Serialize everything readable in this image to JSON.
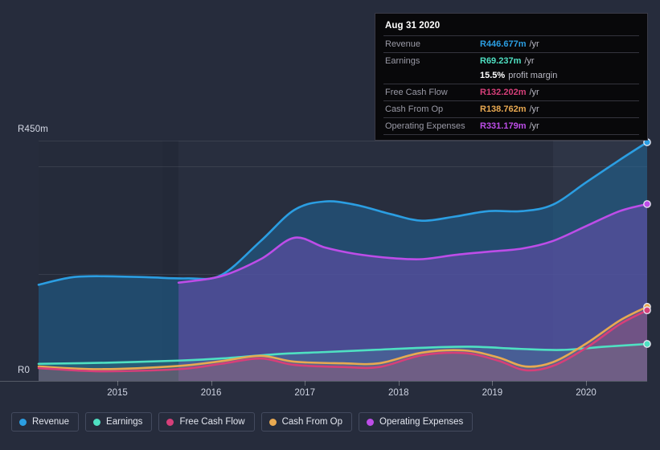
{
  "chart_data": {
    "type": "area",
    "title": "",
    "currency_prefix": "R",
    "xlabel": "",
    "ylabel": "",
    "ylim": [
      0,
      450
    ],
    "ytick_labels": [
      "R450m",
      "R0"
    ],
    "ytick_values": [
      450,
      0
    ],
    "grid": true,
    "x_tick_labels": [
      "2015",
      "2016",
      "2017",
      "2018",
      "2019",
      "2020"
    ],
    "legend_position": "bottom-left",
    "series": [
      {
        "name": "Revenue",
        "color": "#2b9ee2",
        "fill": "rgba(31,100,150,0.55)",
        "points": [
          [
            0.0,
            180
          ],
          [
            0.055,
            194
          ],
          [
            0.11,
            196
          ],
          [
            0.18,
            194
          ],
          [
            0.245,
            192
          ],
          [
            0.3,
            198
          ],
          [
            0.365,
            262
          ],
          [
            0.42,
            320
          ],
          [
            0.47,
            336
          ],
          [
            0.52,
            330
          ],
          [
            0.58,
            312
          ],
          [
            0.63,
            300
          ],
          [
            0.685,
            308
          ],
          [
            0.74,
            318
          ],
          [
            0.795,
            318
          ],
          [
            0.845,
            330
          ],
          [
            0.9,
            372
          ],
          [
            0.955,
            414
          ],
          [
            1.0,
            447
          ]
        ],
        "endpoint_value": 446.677
      },
      {
        "name": "Earnings",
        "color": "#4fe0c2",
        "fill": "rgba(70,160,160,0.22)",
        "points": [
          [
            0.0,
            32
          ],
          [
            0.11,
            34
          ],
          [
            0.23,
            38
          ],
          [
            0.3,
            42
          ],
          [
            0.39,
            50
          ],
          [
            0.47,
            54
          ],
          [
            0.55,
            58
          ],
          [
            0.63,
            62
          ],
          [
            0.71,
            64
          ],
          [
            0.79,
            60
          ],
          [
            0.86,
            58
          ],
          [
            0.93,
            64
          ],
          [
            1.0,
            69.2
          ]
        ],
        "endpoint_value": 69.237
      },
      {
        "name": "Free Cash Flow",
        "color": "#d63f79",
        "fill": "rgba(180,70,120,0.22)",
        "points": [
          [
            0.0,
            24
          ],
          [
            0.1,
            18
          ],
          [
            0.23,
            22
          ],
          [
            0.3,
            32
          ],
          [
            0.365,
            42
          ],
          [
            0.42,
            30
          ],
          [
            0.5,
            26
          ],
          [
            0.56,
            26
          ],
          [
            0.63,
            48
          ],
          [
            0.7,
            52
          ],
          [
            0.755,
            38
          ],
          [
            0.8,
            20
          ],
          [
            0.845,
            28
          ],
          [
            0.9,
            62
          ],
          [
            0.955,
            106
          ],
          [
            1.0,
            132.2
          ]
        ],
        "endpoint_value": 132.202
      },
      {
        "name": "Cash From Op",
        "color": "#e8a951",
        "fill": "rgba(200,150,80,0.15)",
        "points": [
          [
            0.0,
            27
          ],
          [
            0.1,
            22
          ],
          [
            0.23,
            28
          ],
          [
            0.3,
            37
          ],
          [
            0.365,
            47
          ],
          [
            0.42,
            36
          ],
          [
            0.5,
            33
          ],
          [
            0.56,
            33
          ],
          [
            0.63,
            53
          ],
          [
            0.7,
            57
          ],
          [
            0.755,
            44
          ],
          [
            0.8,
            27
          ],
          [
            0.845,
            35
          ],
          [
            0.9,
            70
          ],
          [
            0.955,
            113
          ],
          [
            1.0,
            138.8
          ]
        ],
        "endpoint_value": 138.762
      },
      {
        "name": "Operating Expenses",
        "color": "#bd4de8",
        "fill": "rgba(98,78,168,0.62)",
        "points": [
          [
            0.23,
            184
          ],
          [
            0.3,
            196
          ],
          [
            0.365,
            228
          ],
          [
            0.42,
            268
          ],
          [
            0.47,
            250
          ],
          [
            0.52,
            238
          ],
          [
            0.58,
            230
          ],
          [
            0.63,
            228
          ],
          [
            0.685,
            236
          ],
          [
            0.74,
            242
          ],
          [
            0.795,
            248
          ],
          [
            0.845,
            262
          ],
          [
            0.9,
            290
          ],
          [
            0.955,
            318
          ],
          [
            1.0,
            331.2
          ]
        ],
        "endpoint_value": 331.179
      }
    ]
  },
  "tooltip": {
    "date": "Aug 31 2020",
    "rows": [
      {
        "label": "Revenue",
        "value": "R446.677m",
        "unit": "/yr",
        "color": "#2b9ee2"
      },
      {
        "label": "Earnings",
        "value": "R69.237m",
        "unit": "/yr",
        "color": "#4fe0c2"
      },
      {
        "label": "",
        "value": "15.5%",
        "unit": "profit margin",
        "color": "#ffffff"
      },
      {
        "label": "Free Cash Flow",
        "value": "R132.202m",
        "unit": "/yr",
        "color": "#d63f79"
      },
      {
        "label": "Cash From Op",
        "value": "R138.762m",
        "unit": "/yr",
        "color": "#e8a951"
      },
      {
        "label": "Operating Expenses",
        "value": "R331.179m",
        "unit": "/yr",
        "color": "#bd4de8"
      }
    ]
  },
  "y_axis": {
    "top_label": "R450m",
    "zero_label": "R0"
  },
  "x_axis": {
    "labels": [
      "2015",
      "2016",
      "2017",
      "2018",
      "2019",
      "2020"
    ]
  },
  "legend": {
    "items": [
      {
        "label": "Revenue",
        "color": "#2b9ee2"
      },
      {
        "label": "Earnings",
        "color": "#4fe0c2"
      },
      {
        "label": "Free Cash Flow",
        "color": "#d63f79"
      },
      {
        "label": "Cash From Op",
        "color": "#e8a951"
      },
      {
        "label": "Operating Expenses",
        "color": "#bd4de8"
      }
    ]
  }
}
